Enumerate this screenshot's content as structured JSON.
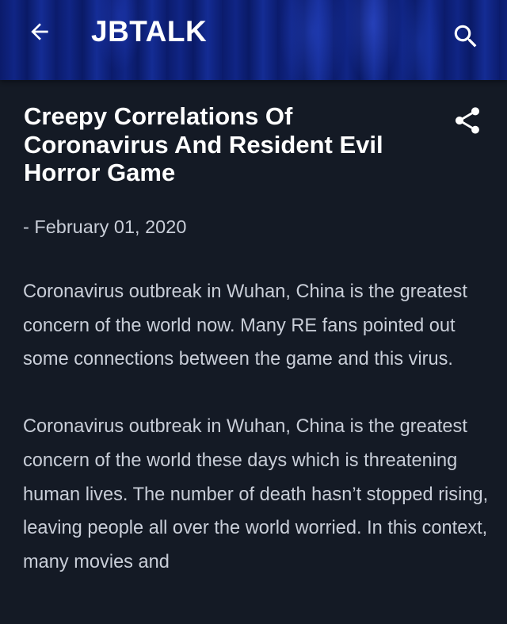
{
  "header": {
    "blog_title": "JBTALK",
    "back_icon": "arrow-left-icon",
    "search_icon": "search-icon"
  },
  "post": {
    "title": "Creepy Correlations Of Coronavirus And Resident Evil Horror Game",
    "date": "- February 01, 2020",
    "share_icon": "share-icon",
    "paragraphs": [
      "Coronavirus outbreak in Wuhan, China is the greatest concern of the world now. Many RE fans pointed out some connections between the game and this virus.",
      "Coronavirus outbreak in Wuhan, China is the greatest concern of the world these days which is threatening human lives. The number of death hasn’t stopped rising, leaving people all over the world worried. In this context, many movies and"
    ]
  },
  "colors": {
    "background": "#141a25",
    "header": "#0e1f76",
    "title_text": "#ffffff",
    "body_text": "#c9ced8"
  }
}
